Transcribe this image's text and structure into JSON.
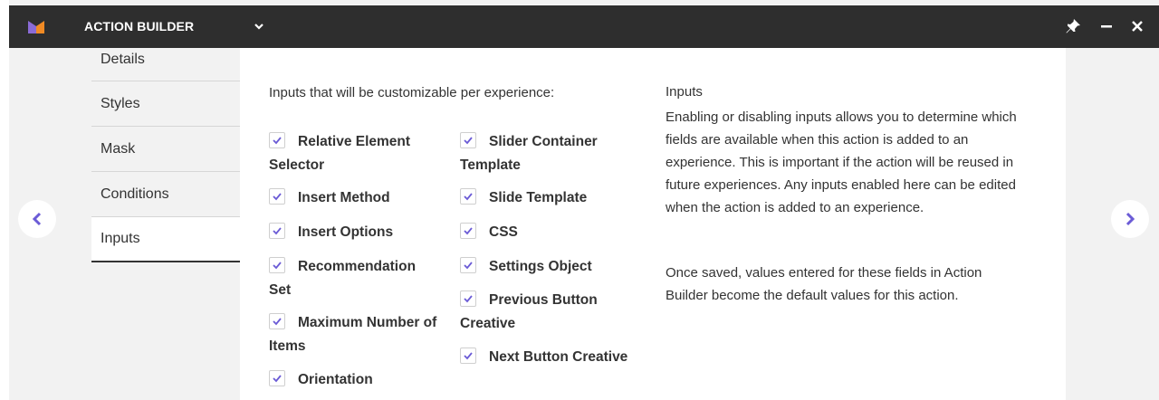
{
  "app": {
    "title": "ACTION BUILDER",
    "accent": "#6b5bd6"
  },
  "sidebar": {
    "items": [
      {
        "label": "Details",
        "active": false
      },
      {
        "label": "Styles",
        "active": false
      },
      {
        "label": "Mask",
        "active": false
      },
      {
        "label": "Conditions",
        "active": false
      },
      {
        "label": "Inputs",
        "active": true
      }
    ]
  },
  "panel": {
    "heading": "Inputs that will be customizable per experience:",
    "left_inputs": [
      {
        "label": "Relative Element Selector",
        "checked": true
      },
      {
        "label": "Insert Method",
        "checked": true
      },
      {
        "label": "Insert Options",
        "checked": true
      },
      {
        "label": "Recommendation Set",
        "checked": true
      },
      {
        "label": "Maximum Number of Items",
        "checked": true
      },
      {
        "label": "Orientation",
        "checked": true
      }
    ],
    "right_inputs": [
      {
        "label": "Slider Container Template",
        "checked": true
      },
      {
        "label": "Slide Template",
        "checked": true
      },
      {
        "label": "CSS",
        "checked": true
      },
      {
        "label": "Settings Object",
        "checked": true
      },
      {
        "label": "Previous Button Creative",
        "checked": true
      },
      {
        "label": "Next Button Creative",
        "checked": true
      }
    ]
  },
  "info": {
    "title": "Inputs",
    "paragraph1": "Enabling or disabling inputs allows you to determine which fields are available when this action is added to an experience. This is important if the action will be reused in future experiences. Any inputs enabled here can be edited when the action is added to an experience.",
    "paragraph2": "Once saved, values entered for these fields in Action Builder become the default values for this action."
  },
  "icons": {
    "logo": "brand-logo-icon",
    "dropdown": "chevron-down-icon",
    "pin": "pin-icon",
    "minimize": "minimize-icon",
    "close": "close-icon",
    "prev": "chevron-left-icon",
    "next": "chevron-right-icon",
    "check": "check-icon"
  }
}
